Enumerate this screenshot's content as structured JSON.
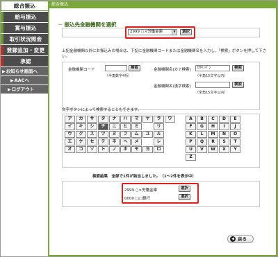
{
  "sidebar": {
    "items": [
      {
        "label": "総合振込",
        "style": "active"
      },
      {
        "label": "給与振込",
        "style": "dark"
      },
      {
        "label": "賞与振込",
        "style": "dark"
      },
      {
        "label": "取引状況照会",
        "style": "dark"
      },
      {
        "label": "登録追加・変更",
        "style": "dark red"
      },
      {
        "label": "承認",
        "style": "dark red"
      }
    ],
    "subs": [
      {
        "label": "お知らせ画面へ"
      },
      {
        "label": "AACへ"
      },
      {
        "label": "ログアウト"
      }
    ]
  },
  "header": {
    "title": "総合振込"
  },
  "main": {
    "section_title": "振込先金融機関を選択",
    "top_select": {
      "value": "2999 ○×労働金庫",
      "button": "選択"
    },
    "instructions": "上記金融機関以外にお振込みの場合は、下記に金融機関コードまたは金融機関名を入力し、「検索」ボタンを押して下さい。",
    "code_label": "金融機関コード",
    "code_hint": "（半角数字4桁）",
    "kana_label": "金融機関名(カナ検索)",
    "kana_value": "ﾛｳｷﾝｷﾞﾝ",
    "kana_hint": "（半角15文字以内）",
    "kanji_label": "金融機関名(漢字検索)",
    "kanji_hint": "（全角15文字以内）",
    "search_label": "検索",
    "char_intro": "文字ボタンによって検索することもできます。",
    "kana_keys": [
      "ア",
      "カ",
      "サ",
      "タ",
      "ナ",
      "ハ",
      "マ",
      "ヤ",
      "ラ",
      "ワ",
      "イ",
      "キ",
      "シ",
      "チ",
      "ニ",
      "ヒ",
      "ミ",
      "",
      "リ",
      "",
      "ウ",
      "ク",
      "ス",
      "ツ",
      "ヌ",
      "フ",
      "ム",
      "ユ",
      "ル",
      "",
      "エ",
      "ケ",
      "セ",
      "テ",
      "ネ",
      "ヘ",
      "メ",
      "",
      "レ",
      "",
      "オ",
      "コ",
      "ソ",
      "ト",
      "ノ",
      "ホ",
      "モ",
      "ヨ",
      "ロ",
      ""
    ],
    "alpha_keys": [
      "A",
      "B",
      "C",
      "D",
      "E",
      "F",
      "G",
      "H",
      "I",
      "J",
      "K",
      "L",
      "M",
      "N",
      "O",
      "P",
      "Q",
      "R",
      "S",
      "T",
      "U",
      "V",
      "W",
      "X",
      "Y",
      "Z"
    ],
    "result_summary": "検索結果　全部で1件が該当しました。（1〜2件を表示中）",
    "results": [
      {
        "name": "2999 ○×労働金庫",
        "button": "選択"
      },
      {
        "name": "0000 □□銀行",
        "button": "選択"
      }
    ],
    "back_label": "戻る"
  },
  "colors": {
    "accent": "#7aa83c",
    "highlight": "#e21f1f",
    "sidebar_dark": "#4c4c4c"
  }
}
